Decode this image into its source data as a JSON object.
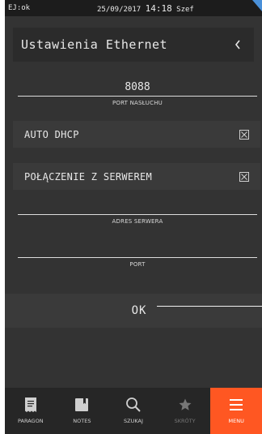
{
  "status": {
    "left": "EJ:ok",
    "date": "25/09/2017",
    "time": "14:18",
    "user": "Szef"
  },
  "header": {
    "title": "Ustawienia Ethernet",
    "back_icon": "chevron-left-icon"
  },
  "fields": {
    "port_listen": {
      "value": "8088",
      "caption": "PORT NASŁUCHU"
    },
    "server_address": {
      "value": "",
      "caption": "ADRES SERWERA"
    },
    "port": {
      "value": "",
      "caption": "PORT"
    }
  },
  "options": {
    "auto_dhcp": {
      "label": "AUTO DHCP",
      "checked": false
    },
    "server_connection": {
      "label": "POŁĄCZENIE Z SERWEREM",
      "checked": false
    }
  },
  "ok_button": {
    "label": "OK"
  },
  "tabs": [
    {
      "label": "PARAGON",
      "icon": "receipt-icon"
    },
    {
      "label": "NOTES",
      "icon": "notebook-icon"
    },
    {
      "label": "SZUKAJ",
      "icon": "search-icon"
    },
    {
      "label": "SKRÓTY",
      "icon": "star-icon"
    },
    {
      "label": "MENU",
      "icon": "menu-icon"
    }
  ],
  "colors": {
    "background": "#333333",
    "accent": "#ff5722",
    "corner_accent": "#4a90d9"
  }
}
